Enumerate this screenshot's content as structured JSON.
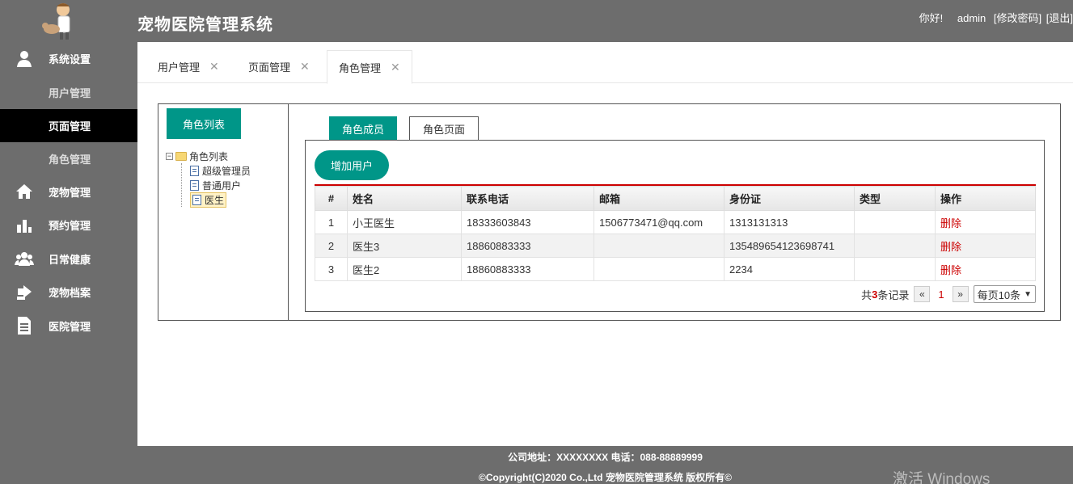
{
  "header": {
    "title": "宠物医院管理系统",
    "greeting": "你好!",
    "username": "admin",
    "change_password": "[修改密码]",
    "logout": "[退出]"
  },
  "sidebar": {
    "system_settings": "系统设置",
    "user_mgmt": "用户管理",
    "page_mgmt": "页面管理",
    "role_mgmt": "角色管理",
    "pet_mgmt": "宠物管理",
    "appointment_mgmt": "预约管理",
    "daily_health": "日常健康",
    "pet_records": "宠物档案",
    "hospital_mgmt": "医院管理"
  },
  "tabs": {
    "user": "用户管理",
    "page": "页面管理",
    "role": "角色管理",
    "close": "✕"
  },
  "left": {
    "role_list_button": "角色列表",
    "tree_root": "角色列表",
    "tree_items": [
      "超级管理员",
      "普通用户",
      "医生"
    ]
  },
  "right": {
    "tab_members": "角色成员",
    "tab_pages": "角色页面",
    "add_user": "增加用户",
    "columns": [
      "#",
      "姓名",
      "联系电话",
      "邮箱",
      "身份证",
      "类型",
      "操作"
    ],
    "rows": [
      [
        "1",
        "小王医生",
        "18333603843",
        "1506773471@qq.com",
        "1313131313",
        "",
        "删除"
      ],
      [
        "2",
        "医生3",
        "18860883333",
        "",
        "135489654123698741",
        "",
        "删除"
      ],
      [
        "3",
        "医生2",
        "18860883333",
        "",
        "2234",
        "",
        "删除"
      ]
    ]
  },
  "pager": {
    "prefix": "共",
    "count": "3",
    "suffix": "条记录",
    "prev": "«",
    "page": "1",
    "next": "»",
    "per_page": "每页10条"
  },
  "footer": {
    "address": "公司地址：XXXXXXXX 电话：088-88889999",
    "copyright": "©Copyright(C)2020 Co.,Ltd 宠物医院管理系统 版权所有©"
  },
  "watermark": "激活 Windows"
}
